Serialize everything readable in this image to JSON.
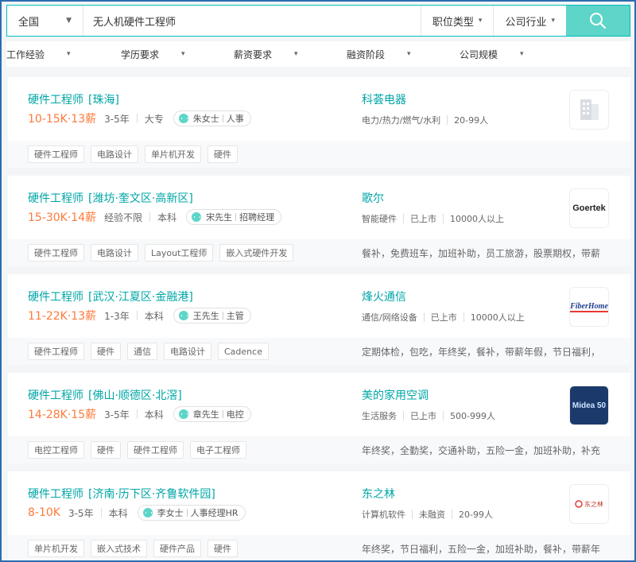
{
  "search": {
    "city": "全国",
    "query": "无人机硬件工程师",
    "job_type_label": "职位类型",
    "industry_label": "公司行业"
  },
  "filters": [
    "工作经验",
    "学历要求",
    "薪资要求",
    "融资阶段",
    "公司规模"
  ],
  "jobs": [
    {
      "title": "硬件工程师",
      "location": "[珠海]",
      "salary": "10-15K·13薪",
      "experience": "3-5年",
      "education": "大专",
      "recruiter": "朱女士",
      "recruiter_role": "人事",
      "tags": [
        "硬件工程师",
        "电路设计",
        "单片机开发",
        "硬件"
      ],
      "company": "科荟电器",
      "industry": "电力/热力/燃气/水利",
      "stage": "",
      "size": "20-99人",
      "benefits": "",
      "logo": "building-icon"
    },
    {
      "title": "硬件工程师",
      "location": "[潍坊·奎文区·高新区]",
      "salary": "15-30K·14薪",
      "experience": "经验不限",
      "education": "本科",
      "recruiter": "宋先生",
      "recruiter_role": "招聘经理",
      "tags": [
        "硬件工程师",
        "电路设计",
        "Layout工程师",
        "嵌入式硬件开发"
      ],
      "company": "歌尔",
      "industry": "智能硬件",
      "stage": "已上市",
      "size": "10000人以上",
      "benefits": "餐补，免费班车，加班补助，员工旅游，股票期权，带薪...",
      "logo": "Goertek"
    },
    {
      "title": "硬件工程师",
      "location": "[武汉·江夏区·金融港]",
      "salary": "11-22K·13薪",
      "experience": "1-3年",
      "education": "本科",
      "recruiter": "王先生",
      "recruiter_role": "主管",
      "tags": [
        "硬件工程师",
        "硬件",
        "通信",
        "电路设计",
        "Cadence"
      ],
      "company": "烽火通信",
      "industry": "通信/网络设备",
      "stage": "已上市",
      "size": "10000人以上",
      "benefits": "定期体检，包吃，年终奖，餐补，带薪年假，节日福利，...",
      "logo": "FiberHome"
    },
    {
      "title": "硬件工程师",
      "location": "[佛山·顺德区·北滘]",
      "salary": "14-28K·15薪",
      "experience": "3-5年",
      "education": "本科",
      "recruiter": "章先生",
      "recruiter_role": "电控",
      "tags": [
        "电控工程师",
        "硬件",
        "硬件工程师",
        "电子工程师"
      ],
      "company": "美的家用空调",
      "industry": "生活服务",
      "stage": "已上市",
      "size": "500-999人",
      "benefits": "年终奖，全勤奖，交通补助，五险一金，加班补助，补充...",
      "logo": "Midea 50"
    },
    {
      "title": "硬件工程师",
      "location": "[济南·历下区·齐鲁软件园]",
      "salary": "8-10K",
      "experience": "3-5年",
      "education": "本科",
      "recruiter": "李女士",
      "recruiter_role": "人事经理HR",
      "tags": [
        "单片机开发",
        "嵌入式技术",
        "硬件产品",
        "硬件"
      ],
      "company": "东之林",
      "industry": "计算机软件",
      "stage": "未融资",
      "size": "20-99人",
      "benefits": "年终奖，节日福利，五险一金，加班补助，餐补，带薪年...",
      "logo": "东之林"
    }
  ]
}
